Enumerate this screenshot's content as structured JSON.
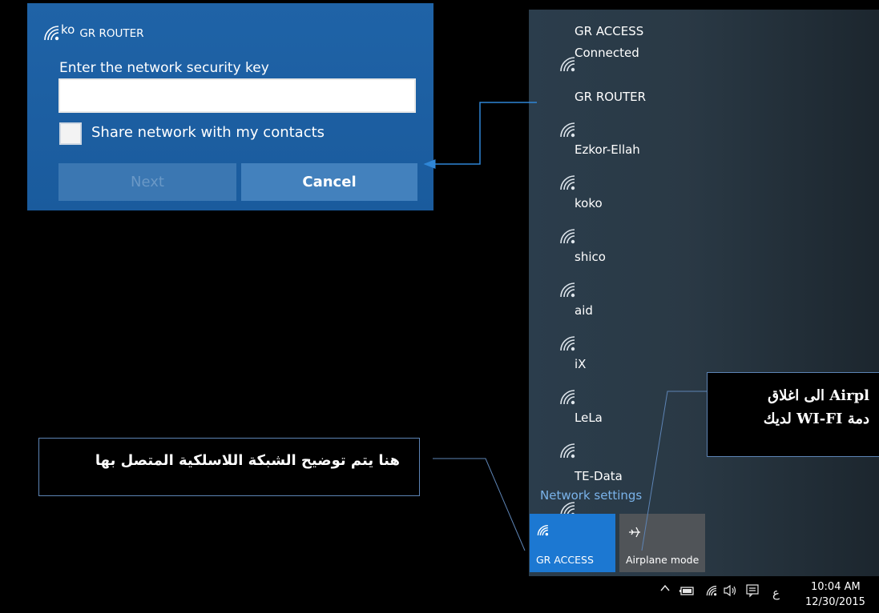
{
  "dialog": {
    "title_prefix": "ko",
    "title_network": "GR ROUTER",
    "prompt": "Enter the network security key",
    "key_value": "",
    "share_label": "Share network with my contacts",
    "share_checked": false,
    "next_label": "Next",
    "cancel_label": "Cancel",
    "icon": "wifi-icon"
  },
  "flyout": {
    "networks": [
      {
        "name": "GR ACCESS",
        "status": "Connected"
      },
      {
        "name": "GR ROUTER",
        "status": ""
      },
      {
        "name": "Ezkor-Ellah",
        "status": ""
      },
      {
        "name": "koko",
        "status": ""
      },
      {
        "name": "shico",
        "status": ""
      },
      {
        "name": "aid",
        "status": ""
      },
      {
        "name": "iX",
        "status": ""
      },
      {
        "name": "LeLa",
        "status": ""
      },
      {
        "name": "TE-Data",
        "status": ""
      }
    ],
    "settings_link": "Network settings",
    "tiles": [
      {
        "label": "GR ACCESS",
        "icon": "wifi-icon",
        "active": true
      },
      {
        "label": "Airplane mode",
        "icon": "airplane-icon",
        "active": false
      }
    ]
  },
  "taskbar": {
    "icons": [
      "chevron-up-icon",
      "battery-icon",
      "wifi-icon",
      "volume-icon",
      "action-center-icon",
      "ime-icon"
    ],
    "ime_label": "ع",
    "time": "10:04 AM",
    "date": "12/30/2015"
  },
  "annotations": {
    "left_text": "هنا يتم توضيح الشبكة اللاسلكية المتصل بها",
    "right_line1": "Airpl الى اغلاق",
    "right_line2": "دمة WI-FI لديك"
  },
  "colors": {
    "dialog_bg": "#1f63a7",
    "accent_tile": "#1c78d2",
    "link": "#7ab3ea",
    "annotation_border": "#5d84b5"
  }
}
